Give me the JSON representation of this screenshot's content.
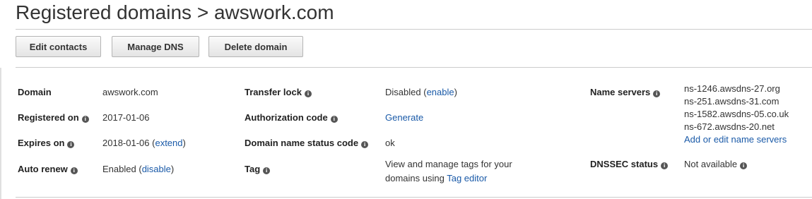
{
  "header": {
    "breadcrumb_parent": "Registered domains",
    "separator": ">",
    "current": "awswork.com"
  },
  "toolbar": {
    "edit_contacts": "Edit contacts",
    "manage_dns": "Manage DNS",
    "delete_domain": "Delete domain"
  },
  "details": {
    "domain": {
      "label": "Domain",
      "value": "awswork.com"
    },
    "registered_on": {
      "label": "Registered on",
      "value": "2017-01-06"
    },
    "expires_on": {
      "label": "Expires on",
      "value": "2018-01-06",
      "paren_open": "(",
      "link": "extend",
      "paren_close": ")"
    },
    "auto_renew": {
      "label": "Auto renew",
      "value": "Enabled",
      "paren_open": "(",
      "link": "disable",
      "paren_close": ")"
    },
    "transfer_lock": {
      "label": "Transfer lock",
      "value": "Disabled",
      "paren_open": "(",
      "link": "enable",
      "paren_close": ")"
    },
    "authorization_code": {
      "label": "Authorization code",
      "link": "Generate"
    },
    "domain_name_status_code": {
      "label": "Domain name status code",
      "value": "ok"
    },
    "tag": {
      "label": "Tag",
      "text_line1": "View and manage tags for your",
      "text_line2": "domains using",
      "link": "Tag editor"
    },
    "name_servers": {
      "label": "Name servers",
      "values": [
        "ns-1246.awsdns-27.org",
        "ns-251.awsdns-31.com",
        "ns-1582.awsdns-05.co.uk",
        "ns-672.awsdns-20.net"
      ],
      "link": "Add or edit name servers"
    },
    "dnssec_status": {
      "label": "DNSSEC status",
      "value": "Not available"
    }
  },
  "icons": {
    "info": "info-icon"
  }
}
